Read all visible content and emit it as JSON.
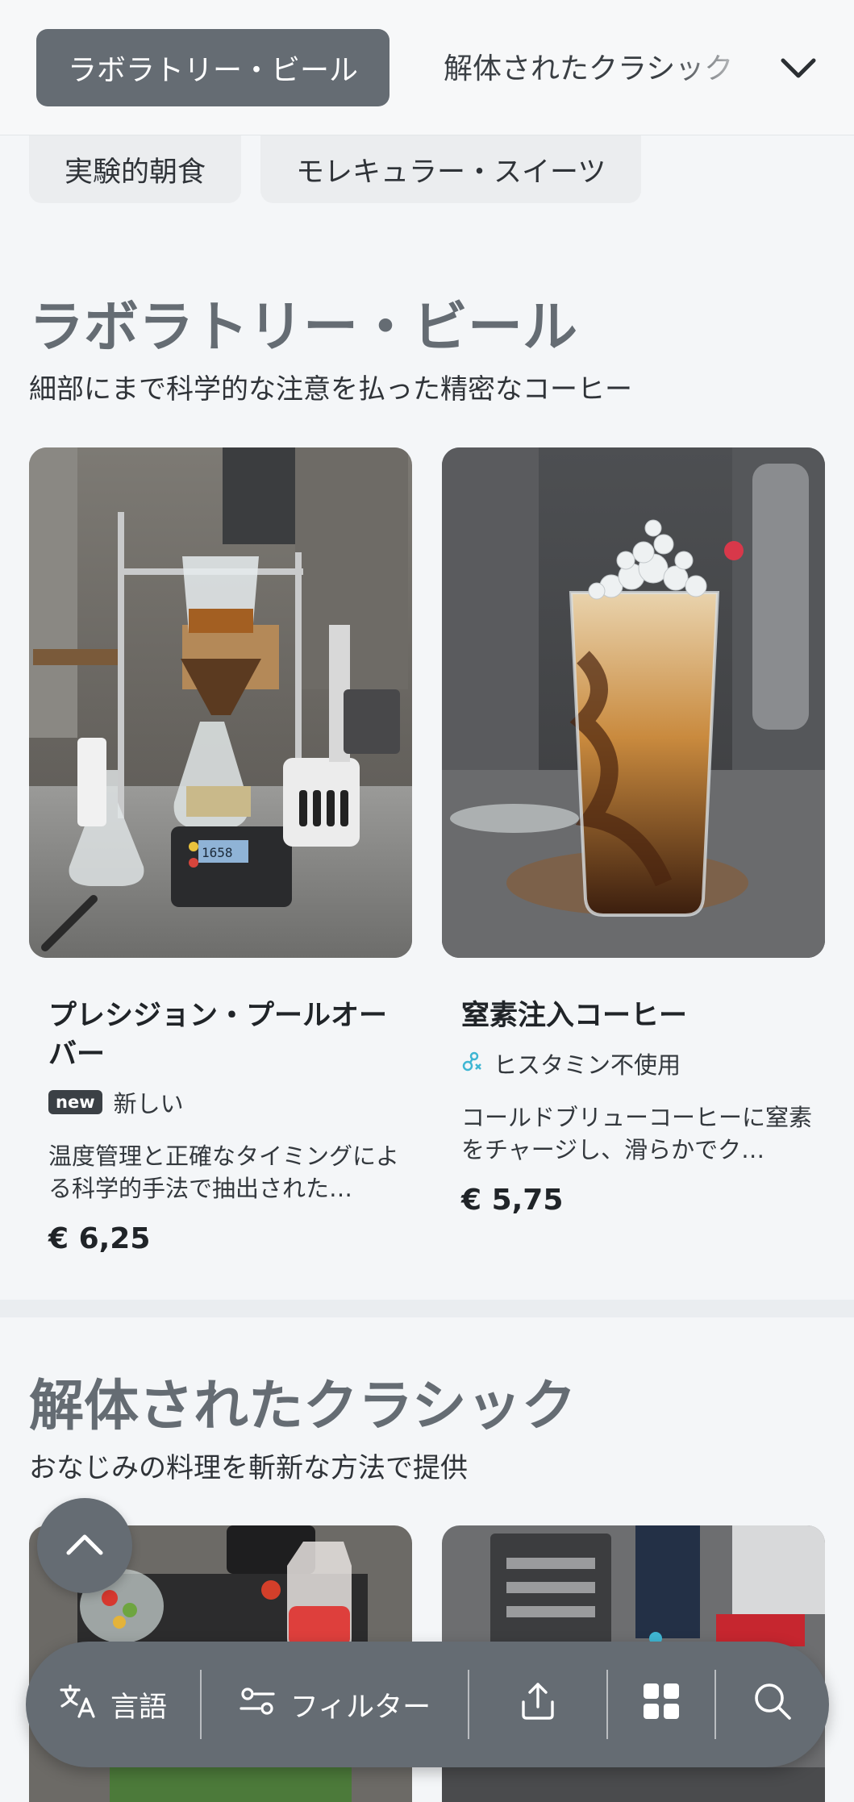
{
  "category_bar": {
    "active": "ラボラトリー・ビール",
    "next": "解体されたクラシック",
    "chips": [
      "実験的朝食",
      "モレキュラー・スイーツ"
    ]
  },
  "sections": [
    {
      "title": "ラボラトリー・ビール",
      "subtitle": "細部にまで科学的な注意を払った精密なコーヒー",
      "products": [
        {
          "name": "プレシジョン・プールオーバー",
          "badge": "new",
          "tag": "新しい",
          "description": "温度管理と正確なタイミングによる科学的手法で抽出された…",
          "price": "€ 6,25",
          "scale_display": "1658"
        },
        {
          "name": "窒素注入コーヒー",
          "tag": "ヒスタミン不使用",
          "description": "コールドブリューコーヒーに窒素をチャージし、滑らかでク…",
          "price": "€ 5,75"
        }
      ]
    },
    {
      "title": "解体されたクラシック",
      "subtitle": "おなじみの料理を斬新な方法で提供"
    }
  ],
  "bottom_bar": {
    "language": "言語",
    "filter": "フィルター"
  },
  "icons": {
    "category_toggle": "chevron-down-icon",
    "scroll_top": "chevron-up-icon",
    "language": "translate-icon",
    "filter": "sliders-icon",
    "share": "share-icon",
    "grid": "grid-icon",
    "search": "search-icon",
    "histamine": "histamine-free-icon"
  },
  "colors": {
    "accent": "#656c73",
    "background": "#f4f6f8"
  }
}
